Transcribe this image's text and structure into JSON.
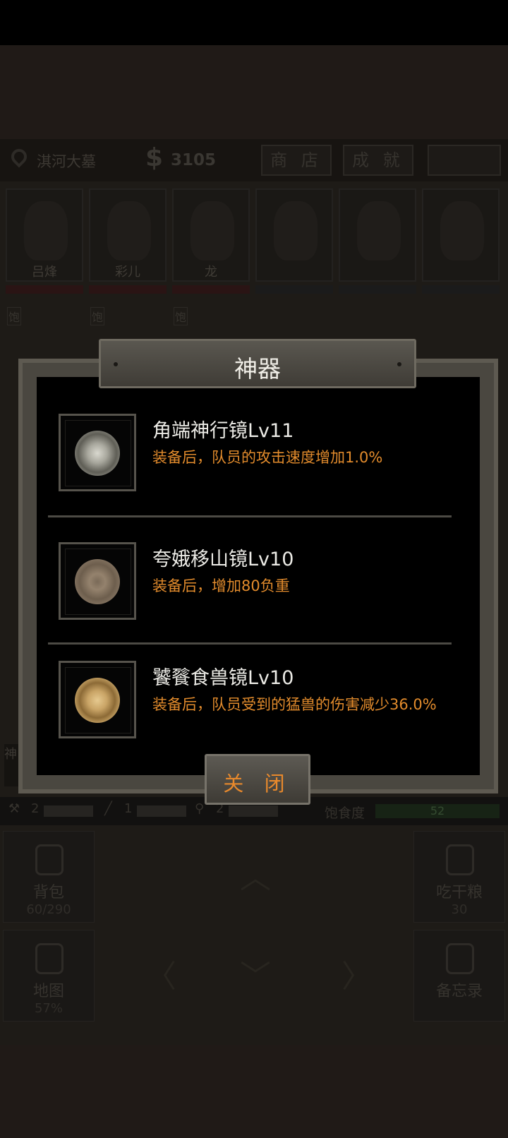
{
  "hud": {
    "location": "淇河大墓",
    "money_symbol": "$",
    "money": "3105",
    "shop_label": "商 店",
    "achievement_label": "成 就"
  },
  "team": [
    {
      "name": "吕烽",
      "hunger": "饱"
    },
    {
      "name": "彩儿",
      "hunger": "饱"
    },
    {
      "name": "龙",
      "hunger": "饱"
    },
    {
      "name": ""
    },
    {
      "name": ""
    },
    {
      "name": ""
    }
  ],
  "tools": {
    "t1": "2",
    "t2": "1",
    "t3": "2",
    "food_label": "饱食度",
    "food_value": "52"
  },
  "actions": {
    "bag_label": "背包",
    "bag_count": "60/290",
    "eat_label": "吃干粮",
    "eat_count": "30",
    "map_label": "地图",
    "map_percent": "57%",
    "memo_label": "备忘录"
  },
  "side_tab": "神",
  "modal": {
    "title": "神器",
    "items": [
      {
        "name": "角端神行镜Lv11",
        "desc": "装备后，队员的攻击速度增加1.0%"
      },
      {
        "name": "夸娥移山镜Lv10",
        "desc": "装备后，增加80负重"
      },
      {
        "name": "饕餮食兽镜Lv10",
        "desc": "装备后，队员受到的猛兽的伤害减少36.0%"
      }
    ],
    "close_label": "关 闭"
  },
  "colors": {
    "accent_orange": "#e28b2c",
    "title_text": "#f1efe8",
    "panel_bg": "#000000"
  }
}
